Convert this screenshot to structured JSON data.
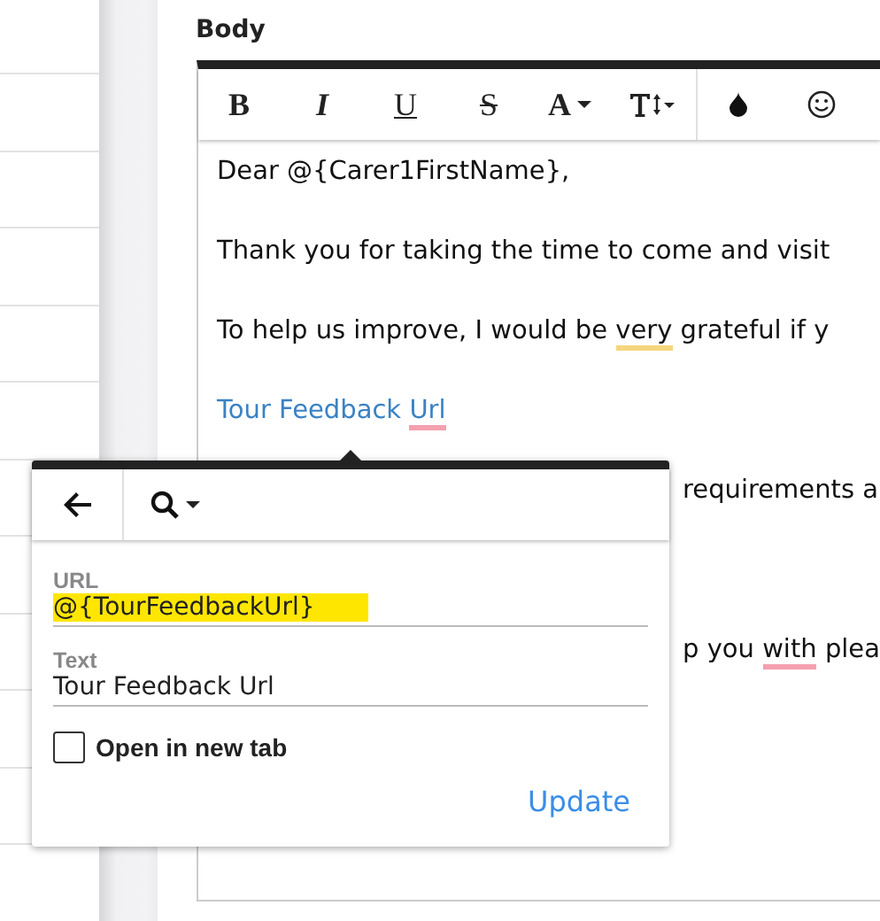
{
  "body_label": "Body",
  "toolbar": [
    {
      "kind": "bold",
      "label": "B"
    },
    {
      "kind": "italic",
      "label": "I"
    },
    {
      "kind": "underline",
      "label": "U"
    },
    {
      "kind": "strike",
      "label": "S"
    },
    {
      "kind": "font-color",
      "label": "A"
    },
    {
      "kind": "font-size"
    },
    {
      "kind": "color"
    },
    {
      "kind": "emoji"
    }
  ],
  "lines": [
    {
      "kind": "text",
      "segments": [
        {
          "text": "Dear @{Carer1FirstName},"
        }
      ]
    },
    {
      "kind": "text",
      "segments": [
        {
          "text": "Thank you for taking the time to come and visit"
        }
      ]
    },
    {
      "kind": "text",
      "segments": [
        {
          "text": "To help us improve, I would be "
        },
        {
          "text": "very",
          "grammar_error": true
        },
        {
          "text": " grateful if y"
        }
      ]
    },
    {
      "kind": "link",
      "segments": [
        {
          "text": "Tour Feedback "
        },
        {
          "text": "Url",
          "spelling_error": true
        }
      ]
    },
    {
      "kind": "covered",
      "segments": [
        {
          "text": "requirements a"
        }
      ]
    },
    {
      "kind": "blank"
    },
    {
      "kind": "covered",
      "segments": [
        {
          "text": "p you "
        },
        {
          "text": "with",
          "spelling_error": true
        },
        {
          "text": " plea"
        }
      ]
    }
  ],
  "link_popover": {
    "fields": [
      {
        "label": "URL",
        "value": "@{TourFeedbackUrl}",
        "highlighted": true
      },
      {
        "label": "Text",
        "value": "Tour Feedback Url",
        "highlighted": false
      }
    ],
    "open_in_new_tab": {
      "label": "Open in new tab",
      "checked": false
    },
    "button": "Update"
  }
}
